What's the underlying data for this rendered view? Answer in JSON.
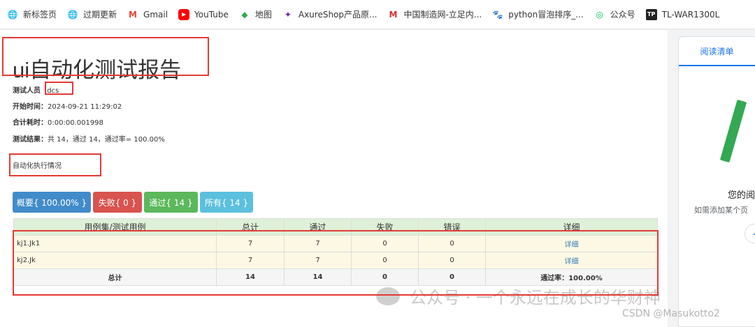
{
  "bookmarks": [
    {
      "icon": "globe-icon",
      "label": "新标签页"
    },
    {
      "icon": "globe-icon",
      "label": "过期更新"
    },
    {
      "icon": "gmail-icon",
      "label": "Gmail"
    },
    {
      "icon": "youtube-icon",
      "label": "YouTube"
    },
    {
      "icon": "maps-icon",
      "label": "地图"
    },
    {
      "icon": "axure-icon",
      "label": "AxureShop产品原..."
    },
    {
      "icon": "mic-icon",
      "label": "中国制造网-立足内..."
    },
    {
      "icon": "baidu-icon",
      "label": "python冒泡排序_..."
    },
    {
      "icon": "wechat-icon",
      "label": "公众号"
    },
    {
      "icon": "tplink-icon",
      "label": "TL-WAR1300L"
    }
  ],
  "colors": {
    "red_box": "#e53935",
    "btn_summary": "#428bca",
    "btn_fail": "#d9534f",
    "btn_pass": "#5cb85c",
    "btn_all": "#5bc0de"
  },
  "report": {
    "title": "ui自动化测试报告",
    "tester_label": "测试人员",
    "tester": "dcs",
    "start_label": "开始时间：",
    "start": "2024-09-21 11:29:02",
    "duration_label": "合计耗时：",
    "duration": "0:00:00.001998",
    "result_label": "测试结果：",
    "result": "共 14，通过 14，通过率= 100.00%",
    "section": "自动化执行情况",
    "buttons": [
      "概要{ 100.00% }",
      "失败{ 0 }",
      "通过{ 14 }",
      "所有{ 14 }"
    ],
    "table": {
      "headers": [
        "用例集/测试用例",
        "总计",
        "通过",
        "失败",
        "错误",
        "详细"
      ],
      "rows": [
        {
          "name": "kj1.Jk1",
          "total": "7",
          "pass": "7",
          "fail": "0",
          "error": "0",
          "detail": "详细"
        },
        {
          "name": "kj2.Jk",
          "total": "7",
          "pass": "7",
          "fail": "0",
          "error": "0",
          "detail": "详细"
        }
      ],
      "total_row": {
        "name": "总计",
        "total": "14",
        "pass": "14",
        "fail": "0",
        "error": "0",
        "detail": "通过率：100.00%"
      }
    }
  },
  "sidebar": {
    "tab": "阅读清单",
    "text1": "您的阅",
    "text2": "如需添加某个页",
    "button": "+"
  },
  "watermark": {
    "text": "公众号 · 一个永远在成长的华财神",
    "csdn": "CSDN @Masukotto2"
  }
}
